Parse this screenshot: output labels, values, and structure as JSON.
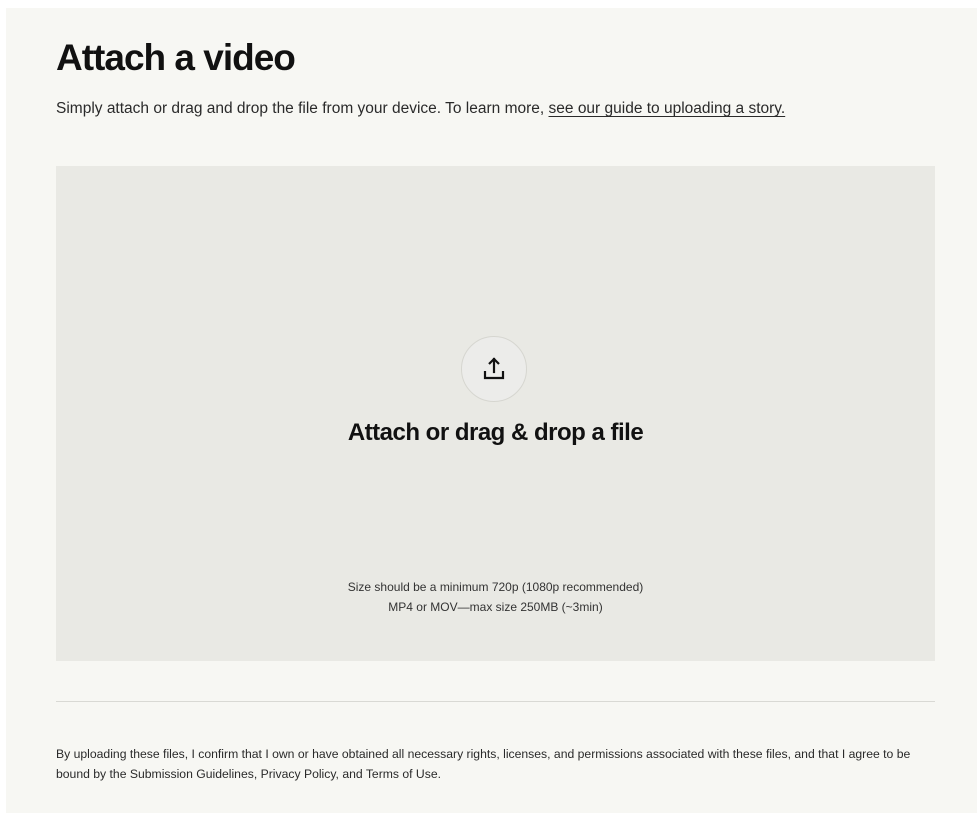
{
  "header": {
    "title": "Attach a video",
    "subtitle_text": "Simply attach or drag and drop the file from your device. To learn more, ",
    "subtitle_link": "see our guide to uploading a story."
  },
  "dropzone": {
    "icon": "upload-icon",
    "heading": "Attach or drag & drop a file",
    "hint_resolution": "Size should be a minimum 720p (1080p recommended)",
    "hint_format": "MP4 or MOV—max size 250MB (~3min)"
  },
  "footer": {
    "disclaimer": "By uploading these files, I confirm that I own or have obtained all necessary rights, licenses, and permissions associated with these files, and that I agree to be bound by the Submission Guidelines, Privacy Policy, and Terms of Use."
  },
  "colors": {
    "page_background": "#f7f7f3",
    "dropzone_background": "#e9e9e4",
    "text": "#111111"
  }
}
